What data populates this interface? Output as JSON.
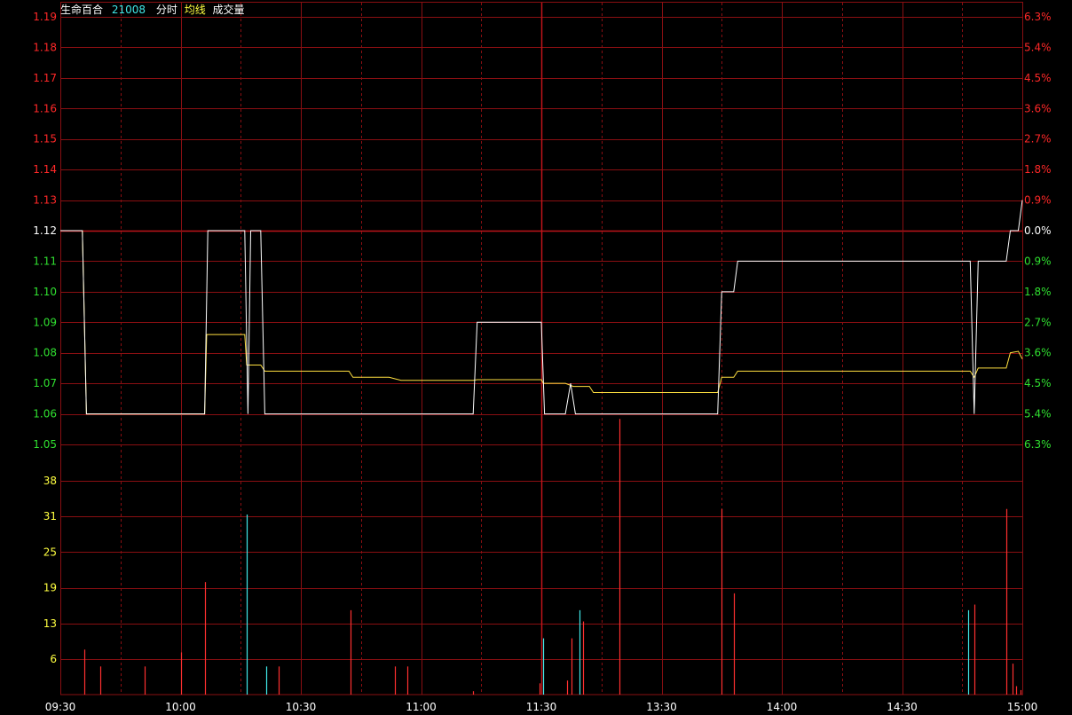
{
  "header": {
    "name": "生命百合",
    "code": "21008",
    "mode": "分时",
    "ma_label": "均线",
    "vol_label": "成交量"
  },
  "colors": {
    "background": "#000000",
    "grid": "#8a0f12",
    "center_line": "#c0141a",
    "up": "#ff2828",
    "down": "#30e030",
    "neutral": "#ffffff",
    "price_line": "#ffffff",
    "avg_line": "#ffe040",
    "vol_up": "#ff3030",
    "vol_down": "#40e8e8",
    "time_label": "#ffffff",
    "vol_label": "#ffff40",
    "header_name": "#ffffff",
    "header_code": "#40e8e8",
    "header_mode": "#ffffff",
    "header_ma": "#ffff40",
    "header_vol": "#ffffff"
  },
  "chart_data": {
    "type": "line",
    "prev_close": 1.12,
    "ylim": [
      1.05,
      1.19
    ],
    "y_ticks": [
      "1.19",
      "1.18",
      "1.17",
      "1.16",
      "1.15",
      "1.14",
      "1.13",
      "1.12",
      "1.11",
      "1.10",
      "1.09",
      "1.08",
      "1.07",
      "1.06",
      "1.05"
    ],
    "pct_ticks": [
      "6.3%",
      "5.4%",
      "4.5%",
      "3.6%",
      "2.7%",
      "1.8%",
      "0.9%",
      "0.0%",
      "0.9%",
      "1.8%",
      "2.7%",
      "3.6%",
      "4.5%",
      "5.4%",
      "6.3%"
    ],
    "x_ticks": [
      "09:30",
      "10:00",
      "10:30",
      "11:00",
      "11:30",
      "13:30",
      "14:00",
      "14:30",
      "15:00"
    ],
    "x_tick_minutes": [
      0,
      30,
      60,
      90,
      120,
      150,
      180,
      210,
      240
    ],
    "minutes_total": 240,
    "price_series": {
      "name": "分时",
      "points": [
        [
          0,
          1.12
        ],
        [
          5.5,
          1.12
        ],
        [
          6.5,
          1.06
        ],
        [
          36,
          1.06
        ],
        [
          36.8,
          1.12
        ],
        [
          46,
          1.12
        ],
        [
          46.8,
          1.06
        ],
        [
          47.5,
          1.12
        ],
        [
          50,
          1.12
        ],
        [
          51,
          1.06
        ],
        [
          103,
          1.06
        ],
        [
          104,
          1.09
        ],
        [
          120,
          1.09
        ],
        [
          120.8,
          1.06
        ],
        [
          126,
          1.06
        ],
        [
          127.3,
          1.07
        ],
        [
          128.5,
          1.06
        ],
        [
          164,
          1.06
        ],
        [
          165,
          1.1
        ],
        [
          168,
          1.1
        ],
        [
          169,
          1.11
        ],
        [
          227,
          1.11
        ],
        [
          228,
          1.06
        ],
        [
          229,
          1.11
        ],
        [
          236,
          1.11
        ],
        [
          237,
          1.12
        ],
        [
          239,
          1.12
        ],
        [
          240,
          1.13
        ]
      ]
    },
    "avg_series": {
      "name": "均线",
      "points": [
        [
          0,
          1.12
        ],
        [
          5.5,
          1.12
        ],
        [
          6.5,
          1.06
        ],
        [
          36,
          1.06
        ],
        [
          36.5,
          1.086
        ],
        [
          46,
          1.086
        ],
        [
          46.5,
          1.076
        ],
        [
          50,
          1.076
        ],
        [
          51,
          1.074
        ],
        [
          72,
          1.074
        ],
        [
          73,
          1.072
        ],
        [
          82,
          1.072
        ],
        [
          85,
          1.071
        ],
        [
          103,
          1.071
        ],
        [
          104,
          1.0712
        ],
        [
          120,
          1.0712
        ],
        [
          120.5,
          1.07
        ],
        [
          126,
          1.07
        ],
        [
          128,
          1.069
        ],
        [
          132,
          1.069
        ],
        [
          133,
          1.067
        ],
        [
          164,
          1.067
        ],
        [
          165,
          1.072
        ],
        [
          168,
          1.072
        ],
        [
          169,
          1.074
        ],
        [
          227,
          1.074
        ],
        [
          228,
          1.072
        ],
        [
          229,
          1.075
        ],
        [
          236,
          1.075
        ],
        [
          237,
          1.08
        ],
        [
          239,
          1.0805
        ],
        [
          240,
          1.078
        ]
      ]
    },
    "volume": {
      "ylim": [
        0,
        44
      ],
      "y_ticks": [
        "38",
        "31",
        "25",
        "19",
        "13",
        "6"
      ],
      "y_tick_values": [
        38,
        31,
        25,
        19,
        13,
        6
      ],
      "bars": [
        [
          6,
          8,
          "up"
        ],
        [
          10,
          5,
          "up"
        ],
        [
          21,
          5,
          "up"
        ],
        [
          30,
          7.5,
          "up"
        ],
        [
          36,
          20,
          "up"
        ],
        [
          46.5,
          32,
          "down"
        ],
        [
          51.3,
          5,
          "down"
        ],
        [
          54.5,
          5,
          "up"
        ],
        [
          72.5,
          15,
          "up"
        ],
        [
          83.5,
          5,
          "up"
        ],
        [
          86.5,
          5,
          "up"
        ],
        [
          103,
          0.6,
          "up"
        ],
        [
          119.5,
          2,
          "up"
        ],
        [
          120.5,
          10,
          "down"
        ],
        [
          126.5,
          2.5,
          "up"
        ],
        [
          127.5,
          10,
          "up"
        ],
        [
          129.5,
          15,
          "down"
        ],
        [
          130.5,
          13,
          "up"
        ],
        [
          139.5,
          49,
          "up"
        ],
        [
          165,
          33,
          "up"
        ],
        [
          168,
          18,
          "up"
        ],
        [
          226.5,
          15,
          "down"
        ],
        [
          228,
          16,
          "up"
        ],
        [
          236,
          33,
          "up"
        ],
        [
          237.5,
          5.5,
          "up"
        ],
        [
          238.5,
          1.5,
          "up"
        ],
        [
          239.5,
          0.8,
          "up"
        ]
      ]
    }
  }
}
